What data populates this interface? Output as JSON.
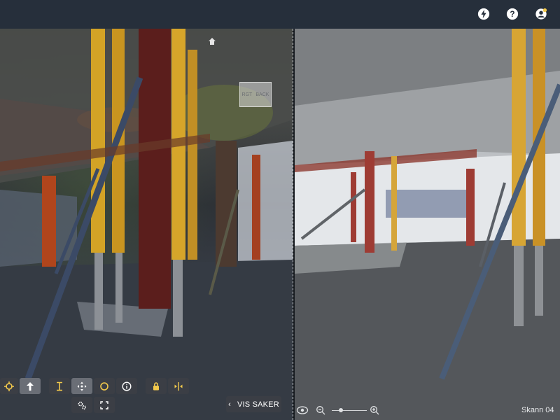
{
  "topbar": {
    "icons": [
      "lightning-icon",
      "help-icon",
      "account-notification-icon"
    ],
    "background": "#262f3b",
    "notification_color": "#f2c94c"
  },
  "left_view": {
    "description_type": "point-cloud",
    "nav_cube": {
      "face_left": "RGT",
      "face_right": "BACK"
    }
  },
  "right_view": {
    "description_type": "photo-360"
  },
  "toolbar": {
    "buttons": [
      {
        "name": "target-icon"
      },
      {
        "name": "walk-arrow-icon"
      },
      {
        "name": "height-measure-icon"
      },
      {
        "name": "move-icon"
      },
      {
        "name": "circle-icon"
      },
      {
        "name": "info-icon"
      },
      {
        "name": "lock-icon"
      },
      {
        "name": "split-view-icon"
      },
      {
        "name": "settings-gears-icon"
      },
      {
        "name": "fullscreen-icon"
      }
    ],
    "accent": "#f2c94c",
    "vis_saker_label": "VIS SAKER"
  },
  "bottom_right": {
    "scan_label": "Skann 04",
    "zoom_level": 0.25
  }
}
